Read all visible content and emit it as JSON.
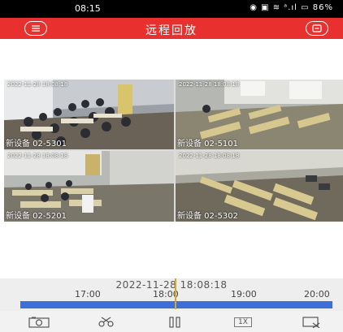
{
  "status_bar": {
    "time": "08:15",
    "icons": "◉ ▣ ≋ ᵃ.ıl ▭ 86%"
  },
  "header": {
    "title": "远程回放",
    "menu_icon": "menu-icon",
    "list_icon": "list-icon"
  },
  "tiles": [
    {
      "label": "新设备 02-5301",
      "osd": "2022-11-28 18:08:18",
      "selected": true
    },
    {
      "label": "新设备 02-5101",
      "osd": "2022-11-28 18:08:18",
      "selected": false
    },
    {
      "label": "新设备 02-5201",
      "osd": "2022-11-28 18:08:18",
      "selected": false
    },
    {
      "label": "新设备 02-5302",
      "osd": "2022-11-28 18:08:18",
      "selected": false
    }
  ],
  "timeline": {
    "datetime": "2022-11-28 18:08:18",
    "ticks": [
      "17:00",
      "18:00",
      "19:00",
      "20:00"
    ],
    "accent": "#3e6fd8",
    "cursor_color": "#d4a829"
  },
  "toolbar": {
    "snapshot_icon": "camera-icon",
    "clip_icon": "scissors-icon",
    "pause_icon": "pause-icon",
    "speed_label": "1X",
    "close_icon": "exit-fullscreen-icon"
  },
  "colors": {
    "header": "#e8302e",
    "status_bar": "#000000"
  }
}
